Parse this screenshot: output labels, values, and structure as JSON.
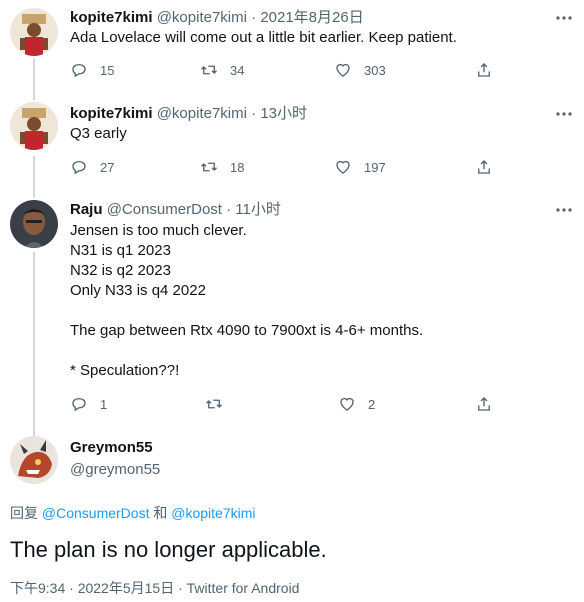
{
  "thread": [
    {
      "name": "kopite7kimi",
      "handle": "@kopite7kimi",
      "time": "2021年8月26日",
      "text": "Ada Lovelace will come out a little bit earlier. Keep patient.",
      "replies": "15",
      "retweets": "34",
      "likes": "303"
    },
    {
      "name": "kopite7kimi",
      "handle": "@kopite7kimi",
      "time": "13小时",
      "text": "Q3 early",
      "replies": "27",
      "retweets": "18",
      "likes": "197"
    },
    {
      "name": "Raju",
      "handle": "@ConsumerDost",
      "time": "11小时",
      "text": "Jensen is too much clever.\nN31 is q1 2023\nN32 is q2 2023\nOnly N33 is q4 2022\n\nThe gap between Rtx 4090 to 7900xt is 4-6+ months.\n\n* Speculation??!",
      "replies": "1",
      "retweets": "",
      "likes": "2"
    }
  ],
  "main_tweet": {
    "name": "Greymon55",
    "handle": "@greymon55",
    "reply_prefix": "回复",
    "reply_user1": "@ConsumerDost",
    "reply_and": "和",
    "reply_user2": "@kopite7kimi",
    "text": "The plan is no longer applicable.",
    "meta": "下午9:34 · 2022年5月15日 · Twitter for Android"
  },
  "separator": "·",
  "icons": {
    "reply": "reply-icon",
    "retweet": "retweet-icon",
    "like": "heart-icon",
    "share": "share-icon",
    "more": "more-icon"
  },
  "colors": {
    "primary_text": "#0f1419",
    "secondary_text": "#536471",
    "link": "#1d9bf0",
    "thread_line": "#cfd9de"
  }
}
